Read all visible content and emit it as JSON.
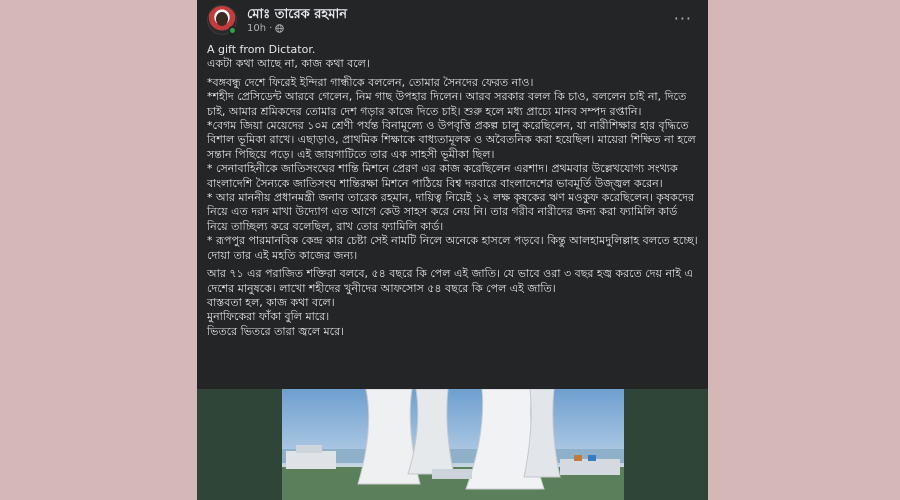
{
  "post": {
    "author": "মোঃ তারেক রহমান",
    "time": "10h",
    "dot": "·",
    "more": "···",
    "icons": {
      "privacy": "globe-icon",
      "more": "more-options-icon"
    }
  },
  "content": {
    "lines_intro": [
      "A gift from Dictator.",
      "একটা কথা আছে না, কাজ কথা বলে।"
    ],
    "paragraphs": [
      "*বঙ্গবন্ধু দেশে ফিরেই ইন্দিরা গান্ধীকে বললেন, তোমার সৈনদের ফেরত নাও।",
      "*শহীদ প্রেসিডেন্ট আরবে গেলেন, নিম গাছ উপহার দিলেন। আরব সরকার বলল কি চাও, বললেন চাই না, দিতে চাই, আমার শ্রমিকদের তোমার দেশ গড়ার কাজে দিতে চাই। শুরু হলে মধ্য প্রাচ্যে মানব সম্পদ রপ্তানি।",
      "*বেগম জিয়া মেয়েদের ১০ম শ্রেণী পর্যন্ত বিনামূল্যে ও উপবৃত্তি প্রকল্প চালু করেছিলেন, যা নারীশিক্ষার হার বৃদ্ধিতে বিশাল ভূমিকা রাখে। এছাড়াও, প্রাথমিক শিক্ষাকে বাধ্যতামূলক ও অবৈতনিক করা হয়েছিল। মায়েরা শিক্ষিত না হলে সন্তান পিছিয়ে পড়ে। এই জায়গাটিতে তার এক সাহসী ভূমীকা ছিল।",
      "* সেনাবাহিনীকে জাতিসংঘের শান্তি মিশনে প্রেরণ এর কাজ করেছিলেন এরশাদ। প্রথমবার উল্লেখযোগ্য সংখ্যক বাংলাদেশি সৈন্যকে জাতিসংঘ শান্তিরক্ষা মিশনে পাঠিয়ে বিশ্ব দরবারে বাংলাদেশের ভাবমূর্তি উজ্জ্বল করেন।",
      "* আর মাননীয় প্রধানমন্ত্রী জনাব তারেক রহমান, দায়িত্ব নিয়েই ১২ লক্ষ কৃষকের ঋণ মওকুফ করেছিলেন। কৃষকদের নিয়ে এত দরদ মাখা উদ্যোগ এত আগে কেউ সাহস করে নেয় নি। তার গরীব নারীদের জন্য করা ফ্যামিলি কার্ড নিয়ে তাচ্ছিল্য করে বলেছিল, রাখ তোর ফ্যামিলি কার্ড।",
      "* রূপপুর পারমানবিক কেন্দ্র কার চেষ্টা সেই নামটি নিলে অনেকে হাসলে পড়বে। কিন্তু আলহামদুলিল্লাহ বলতে হচ্ছে। দোয়া তার এই মহতি কাজের জন্য।"
    ],
    "closing": [
      "আর ৭১ এর পরাজিত শক্তিরা বলবে, ৫৪ বছরে কি পেল এই জাতি। যে ভাবে ওরা ৩ বছর হজ্ব করতে দেয় নাই এ দেশের মানুষকে। লাখো শহীদের খুনীদের আফসোস ৫৪ বছরে কি পেল এই জাতি।",
      "বাস্তবতা হল, কাজ কথা বলে।",
      "মুনাফিকেরা ফাঁকা বুলি মারে।",
      "ভিতরে ভিতরে তারা জ্বলে মরে।"
    ]
  },
  "colors": {
    "page_bg": "#d6b7b7",
    "card_bg": "#242526",
    "text": "#e4e6eb",
    "secondary_text": "#b0b3b8",
    "online": "#31a24c"
  }
}
